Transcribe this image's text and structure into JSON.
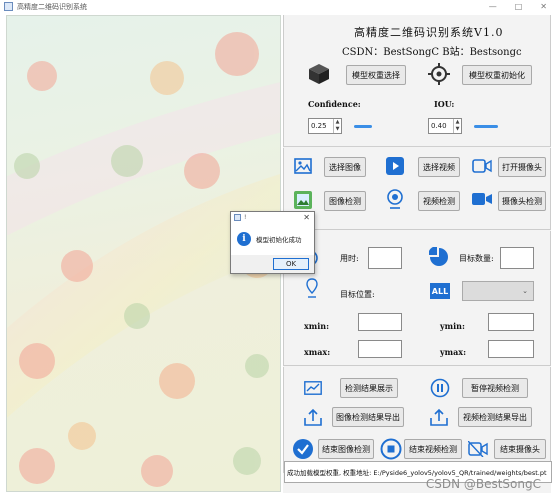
{
  "window": {
    "title": "高精度二维码识别系统"
  },
  "header": {
    "title": "高精度二维码识别系统V1.0",
    "credits": "CSDN：BestSongC   B站：Bestsongc"
  },
  "model": {
    "select_weights_button": "模型权重选择",
    "init_weights_button": "模型权重初始化",
    "confidence_label": "Confidence:",
    "confidence_value": "0.25",
    "iou_label": "IOU:",
    "iou_value": "0.40"
  },
  "inputs": {
    "select_image_button": "选择图像",
    "select_video_button": "选择视频",
    "open_camera_button": "打开摄像头",
    "image_detect_button": "图像检测",
    "video_detect_button": "视频检测",
    "camera_detect_button": "摄像头检测"
  },
  "results": {
    "time_label": "用时:",
    "target_count_label": "目标数量:",
    "target_position_label": "目标位置:",
    "all_icon_text": "ALL",
    "xmin_label": "xmin:",
    "ymin_label": "ymin:",
    "xmax_label": "xmax:",
    "ymax_label": "ymax:"
  },
  "actions": {
    "show_results_button": "检测结果展示",
    "pause_video_button": "暂停视频检测",
    "export_image_results_button": "图像检测结果导出",
    "export_video_results_button": "视频检测结果导出",
    "end_image_detect_button": "结束图像检测",
    "end_video_detect_button": "结束视频检测",
    "end_camera_button": "结束摄像头"
  },
  "status": {
    "message": "成功加载模型权重, 权重地址: E:/Pyside6_yolov5/yolov5_QR/trained/weights/best.pt"
  },
  "dialog": {
    "title": "!",
    "message": "模型初始化成功",
    "ok_button": "OK"
  },
  "watermark": "CSDN @BestSongC",
  "colors": {
    "accent": "#3a8ee6",
    "info": "#1f6fd1"
  }
}
